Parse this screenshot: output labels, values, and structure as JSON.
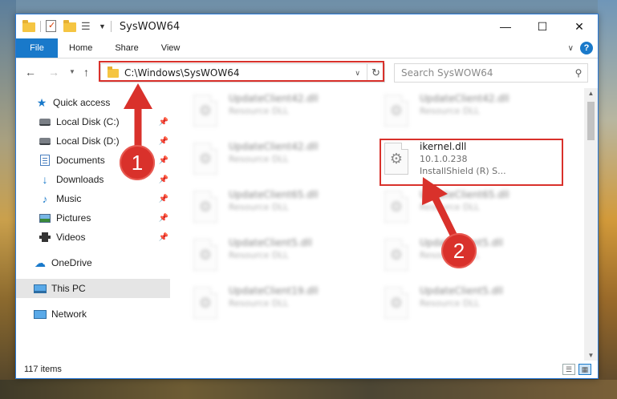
{
  "window": {
    "title": "SysWOW64",
    "controls": {
      "minimize": "—",
      "maximize": "☐",
      "close": "✕"
    }
  },
  "ribbon": {
    "tabs": [
      "File",
      "Home",
      "Share",
      "View"
    ],
    "help": "?"
  },
  "address": {
    "path": "C:\\Windows\\SysWOW64"
  },
  "search": {
    "placeholder": "Search SysWOW64"
  },
  "nav": {
    "quick_access": "Quick access",
    "items": [
      {
        "label": "Local Disk (C:)",
        "icon": "disk-icon",
        "pinned": true
      },
      {
        "label": "Local Disk (D:)",
        "icon": "disk-icon",
        "pinned": true
      },
      {
        "label": "Documents",
        "icon": "documents-icon",
        "pinned": true
      },
      {
        "label": "Downloads",
        "icon": "download-icon",
        "pinned": true
      },
      {
        "label": "Music",
        "icon": "music-icon",
        "pinned": true
      },
      {
        "label": "Pictures",
        "icon": "pictures-icon",
        "pinned": true
      },
      {
        "label": "Videos",
        "icon": "videos-icon",
        "pinned": true
      }
    ],
    "onedrive": "OneDrive",
    "this_pc": "This PC",
    "network": "Network"
  },
  "files": [
    {
      "name": "UpdateClient42.dll",
      "meta1": "Resource DLL",
      "meta2": "",
      "blurred": true
    },
    {
      "name": "UpdateClient42.dll",
      "meta1": "Resource DLL",
      "meta2": "",
      "blurred": true
    },
    {
      "name": "UpdateClient42.dll",
      "meta1": "Resource DLL",
      "meta2": "",
      "blurred": true
    },
    {
      "name": "ikernel.dll",
      "meta1": "10.1.0.238",
      "meta2": "InstallShield (R) S...",
      "blurred": false
    },
    {
      "name": "UpdateClient65.dll",
      "meta1": "Resource DLL",
      "meta2": "",
      "blurred": true
    },
    {
      "name": "UpdateClient65.dll",
      "meta1": "Resource DLL",
      "meta2": "",
      "blurred": true
    },
    {
      "name": "UpdateClient5.dll",
      "meta1": "Resource DLL",
      "meta2": "",
      "blurred": true
    },
    {
      "name": "UpdateClient5.dll",
      "meta1": "Resource DLL",
      "meta2": "",
      "blurred": true
    },
    {
      "name": "UpdateClient19.dll",
      "meta1": "Resource DLL",
      "meta2": "",
      "blurred": true
    },
    {
      "name": "UpdateClient5.dll",
      "meta1": "Resource DLL",
      "meta2": "",
      "blurred": true
    }
  ],
  "status": {
    "count": "117 items"
  },
  "annotations": {
    "badge1": "1",
    "badge2": "2",
    "color": "#d9312b"
  }
}
